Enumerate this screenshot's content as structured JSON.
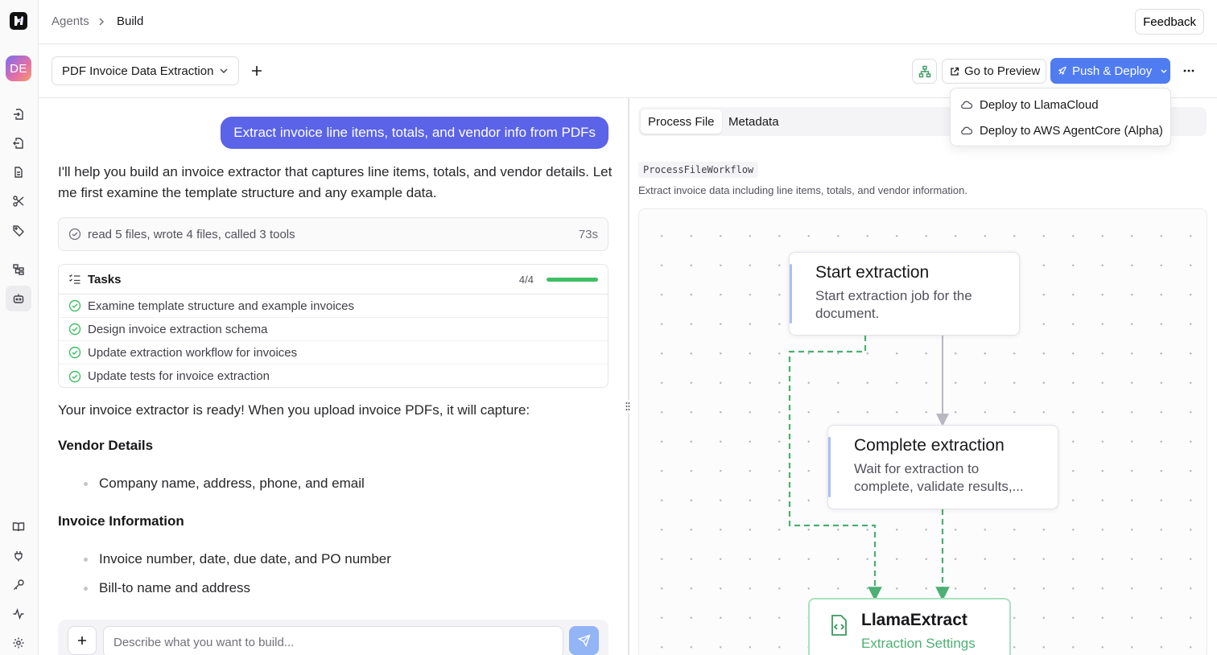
{
  "app": {
    "avatar_initials": "DE"
  },
  "breadcrumb": {
    "root": "Agents",
    "current": "Build"
  },
  "header": {
    "feedback_label": "Feedback"
  },
  "toolbar": {
    "agent_name": "PDF Invoice Data Extraction",
    "go_to_preview_label": "Go to Preview",
    "push_deploy_label": "Push & Deploy"
  },
  "deploy_menu": {
    "items": [
      {
        "label": "Deploy to LlamaCloud"
      },
      {
        "label": "Deploy to AWS AgentCore (Alpha)"
      }
    ]
  },
  "chat": {
    "user_message": "Extract invoice line items, totals, and vendor info from PDFs",
    "assistant_intro": "I'll help you build an invoice extractor that captures line items, totals, and vendor details. Let me first examine the template structure and any example data.",
    "activity_summary": "read 5 files, wrote 4 files, called 3 tools",
    "activity_time": "73s",
    "tasks": {
      "title": "Tasks",
      "count": "4/4",
      "progress": 1.0,
      "items": [
        {
          "label": "Examine template structure and example invoices",
          "done": true
        },
        {
          "label": "Design invoice extraction schema",
          "done": true
        },
        {
          "label": "Update extraction workflow for invoices",
          "done": true
        },
        {
          "label": "Update tests for invoice extraction",
          "done": true
        }
      ]
    },
    "ready_text": "Your invoice extractor is ready! When you upload invoice PDFs, it will capture:",
    "sections": [
      {
        "heading": "Vendor Details",
        "bullets": [
          "Company name, address, phone, and email"
        ]
      },
      {
        "heading": "Invoice Information",
        "bullets": [
          "Invoice number, date, due date, and PO number",
          "Bill-to name and address"
        ]
      }
    ],
    "composer_placeholder": "Describe what you want to build..."
  },
  "workflow": {
    "tabs": [
      {
        "label": "Process File",
        "active": true
      },
      {
        "label": "Metadata",
        "active": false
      }
    ],
    "name": "ProcessFileWorkflow",
    "description": "Extract invoice data including line items, totals, and vendor information.",
    "nodes": [
      {
        "title": "Start extraction",
        "description": "Start extraction job for the document."
      },
      {
        "title": "Complete extraction",
        "description": "Wait for extraction to complete, validate results,..."
      },
      {
        "title": "LlamaExtract",
        "description": "Extraction Settings"
      }
    ]
  },
  "colors": {
    "accent": "#5b63e8",
    "deploy": "#4f7cf0",
    "success": "#3fbf63",
    "edge_green": "#4caf73"
  },
  "icons": [
    "logo-icon",
    "import-icon",
    "export-icon",
    "document-icon",
    "scissors-icon",
    "tag-icon",
    "workflow-icon",
    "robot-icon",
    "book-icon",
    "plug-icon",
    "key-icon",
    "activity-icon",
    "gear-icon"
  ]
}
